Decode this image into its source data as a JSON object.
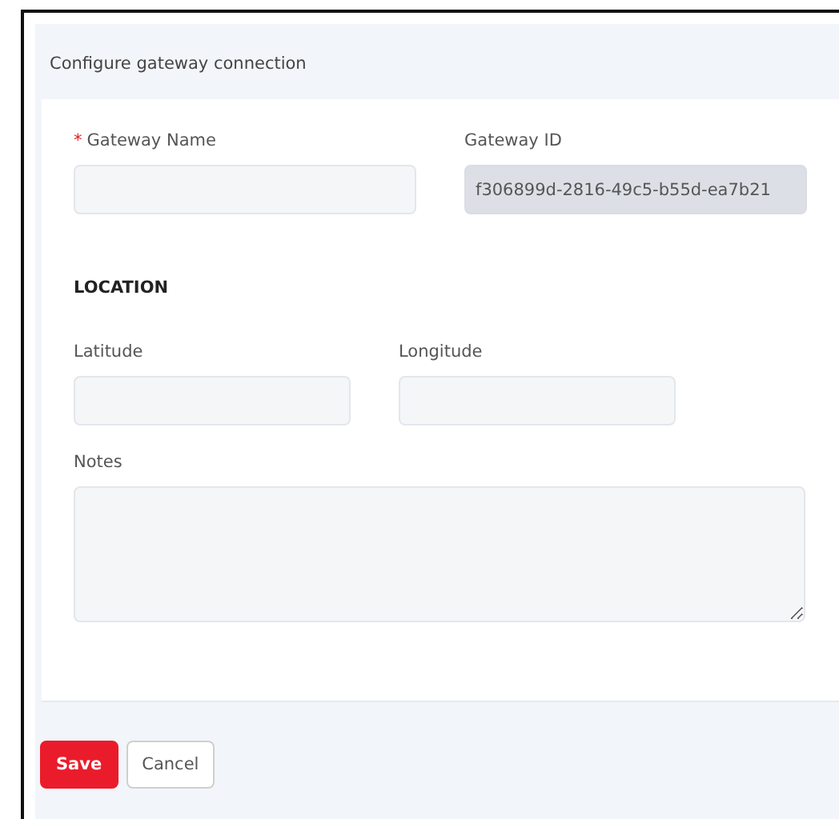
{
  "panel": {
    "title": "Configure gateway connection"
  },
  "gateway_fields": [
    {
      "label": "Gateway Name",
      "required_mark": "*",
      "disabled": false
    },
    {
      "label": "Gateway ID",
      "value": "f306899d-2816-49c5-b55d-ea7b21",
      "disabled": true
    }
  ],
  "location": {
    "heading": "LOCATION",
    "fields": [
      {
        "label": "Latitude",
        "disabled": false
      },
      {
        "label": "Longitude",
        "disabled": false
      }
    ]
  },
  "notes": {
    "label": "Notes"
  },
  "buttons": [
    {
      "label": "Save",
      "kind": "primary"
    },
    {
      "label": "Cancel",
      "kind": "secondary"
    }
  ]
}
